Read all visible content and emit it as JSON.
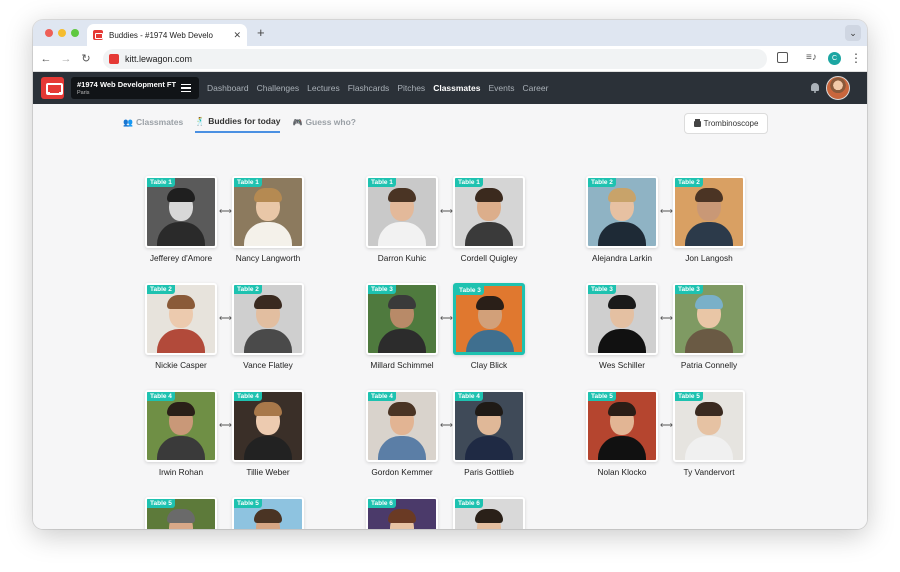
{
  "browser": {
    "tab_title": "Buddies - #1974 Web Develo",
    "url": "kitt.lewagon.com",
    "profile_initial": "C"
  },
  "app": {
    "batch_name": "#1974 Web Development FT",
    "batch_city": "Paris",
    "nav_links": [
      "Dashboard",
      "Challenges",
      "Lectures",
      "Flashcards",
      "Pitches",
      "Classmates",
      "Events",
      "Career"
    ],
    "active_nav": "Classmates"
  },
  "subnav": {
    "tabs": [
      "Classmates",
      "Buddies for today",
      "Guess who?"
    ],
    "active": "Buddies for today",
    "trombinoscope_label": "Trombinoscope"
  },
  "colors": {
    "accent": "#1ec2b0",
    "nav_bg": "#2b3138",
    "tab_underline": "#4a90e2"
  },
  "pairs": [
    {
      "left": {
        "name": "Jefferey d'Amore",
        "table": "Table 1",
        "bg": "#5a5a5a",
        "skin": "#d8d8d8",
        "shirt": "#2a2a2a",
        "hair": "#1f1f1f"
      },
      "right": {
        "name": "Nancy Langworth",
        "table": "Table 1",
        "bg": "#8c7a5e",
        "skin": "#e9c7a7",
        "shirt": "#f4f1ea",
        "hair": "#b58a52"
      }
    },
    {
      "left": {
        "name": "Darron Kuhic",
        "table": "Table 1",
        "bg": "#c9c9c9",
        "skin": "#e3b99a",
        "shirt": "#f2f2f2",
        "hair": "#4a3424"
      },
      "right": {
        "name": "Cordell Quigley",
        "table": "Table 1",
        "bg": "#d5d5d5",
        "skin": "#dcae8b",
        "shirt": "#3a3a3a",
        "hair": "#3b2a1e"
      }
    },
    {
      "left": {
        "name": "Alejandra Larkin",
        "table": "Table 2",
        "bg": "#8fb3c4",
        "skin": "#e7c1a2",
        "shirt": "#1e2a36",
        "hair": "#c8a36a"
      },
      "right": {
        "name": "Jon Langosh",
        "table": "Table 2",
        "bg": "#d9a063",
        "skin": "#c99876",
        "shirt": "#2c3a4a",
        "hair": "#4b3424"
      }
    },
    {
      "left": {
        "name": "Nickie Casper",
        "table": "Table 2",
        "bg": "#e7e3dc",
        "skin": "#eccaae",
        "shirt": "#b24a3a",
        "hair": "#8a5a38"
      },
      "right": {
        "name": "Vance Flatley",
        "table": "Table 2",
        "bg": "#cfcfcf",
        "skin": "#e2bea0",
        "shirt": "#4a4a4a",
        "hair": "#3a2a20"
      }
    },
    {
      "left": {
        "name": "Millard Schimmel",
        "table": "Table 3",
        "bg": "#4f7a3e",
        "skin": "#b88a68",
        "shirt": "#2c2c2c",
        "hair": "#3a3a3a"
      },
      "right": {
        "name": "Clay Blick",
        "table": "Table 3",
        "bg": "#e0782f",
        "skin": "#d2a079",
        "shirt": "#3f6f8f",
        "hair": "#2a1f18",
        "highlight": true
      }
    },
    {
      "left": {
        "name": "Wes Schiller",
        "table": "Table 3",
        "bg": "#cfcfcf",
        "skin": "#e4c0a2",
        "shirt": "#111111",
        "hair": "#1a1a1a"
      },
      "right": {
        "name": "Patria Connelly",
        "table": "Table 3",
        "bg": "#7f9a63",
        "skin": "#e9c6a6",
        "shirt": "#6a5a44",
        "hair": "#7ab0c8"
      }
    },
    {
      "left": {
        "name": "Irwin Rohan",
        "table": "Table 4",
        "bg": "#6f8f45",
        "skin": "#c99878",
        "shirt": "#3a3a3a",
        "hair": "#2a1f18"
      },
      "right": {
        "name": "Tillie Weber",
        "table": "Table 4",
        "bg": "#3a2f28",
        "skin": "#edcbb0",
        "shirt": "#222222",
        "hair": "#a8784a"
      }
    },
    {
      "left": {
        "name": "Gordon Kemmer",
        "table": "Table 4",
        "bg": "#d9d3cc",
        "skin": "#e2b493",
        "shirt": "#5b7ea6",
        "hair": "#4a3424"
      },
      "right": {
        "name": "Paris Gottlieb",
        "table": "Table 4",
        "bg": "#3f4a58",
        "skin": "#e0b898",
        "shirt": "#1f2a44",
        "hair": "#1f1a16"
      }
    },
    {
      "left": {
        "name": "Nolan Klocko",
        "table": "Table 5",
        "bg": "#b5452f",
        "skin": "#e2b594",
        "shirt": "#111111",
        "hair": "#2a1d16"
      },
      "right": {
        "name": "Ty Vandervort",
        "table": "Table 5",
        "bg": "#e6e4e0",
        "skin": "#e6c2a3",
        "shirt": "#f0f0f0",
        "hair": "#3a2a20"
      }
    },
    {
      "left": {
        "name": "",
        "table": "Table 5",
        "bg": "#5d7a3a",
        "skin": "#d8a888",
        "shirt": "#3a3a3a",
        "hair": "#6a6a6a"
      },
      "right": {
        "name": "",
        "table": "Table 5",
        "bg": "#8ec3e0",
        "skin": "#d6a684",
        "shirt": "#1f3a5a",
        "hair": "#4a3424"
      }
    },
    {
      "left": {
        "name": "",
        "table": "Table 6",
        "bg": "#4b3a6a",
        "skin": "#e7c3a4",
        "shirt": "#5a3a2a",
        "hair": "#6a3a24"
      },
      "right": {
        "name": "",
        "table": "Table 6",
        "bg": "#d9d9d9",
        "skin": "#e4bfa0",
        "shirt": "#2a2a2a",
        "hair": "#2a2018"
      }
    }
  ]
}
